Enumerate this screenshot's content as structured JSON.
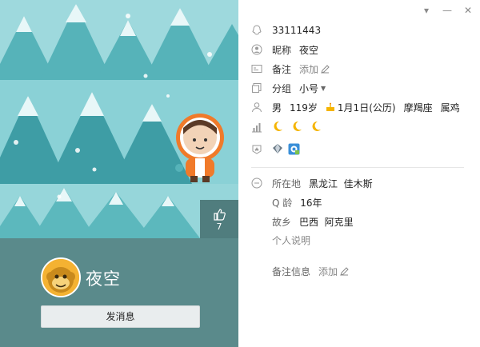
{
  "profile": {
    "qq_number": "33111443",
    "nickname_label": "昵称",
    "nickname": "夜空",
    "remark_label": "备注",
    "remark_add": "添加",
    "group_label": "分组",
    "group_value": "小号",
    "gender": "男",
    "age": "119岁",
    "birthday": "1月1日(公历)",
    "zodiac": "摩羯座",
    "chinese_zodiac": "属鸡",
    "location_label": "所在地",
    "location": "黑龙江  佳木斯",
    "qage_label": "Q 龄",
    "qage": "16年",
    "hometown_label": "故乡",
    "hometown": "巴西  阿克里",
    "signature_label": "个人说明",
    "remark_info_label": "备注信息",
    "remark_info_add": "添加"
  },
  "left": {
    "display_name": "夜空",
    "send_message_label": "发消息",
    "like_count": "7"
  },
  "colors": {
    "banner_bg": "#8fd3d8",
    "profile_bg": "#5a8a8b",
    "icon_gray": "#9a9a9a",
    "moon": "#f5b400"
  },
  "icons": {
    "qq": "qq-penguin-icon",
    "nickname": "user-circle-icon",
    "remark": "card-icon",
    "group": "group-icon",
    "person": "person-icon",
    "level": "level-bars-icon",
    "badge": "badge-icon",
    "location": "location-dot-icon",
    "edit": "pencil-icon",
    "like": "thumbs-up-icon",
    "birthday": "cake-icon"
  }
}
